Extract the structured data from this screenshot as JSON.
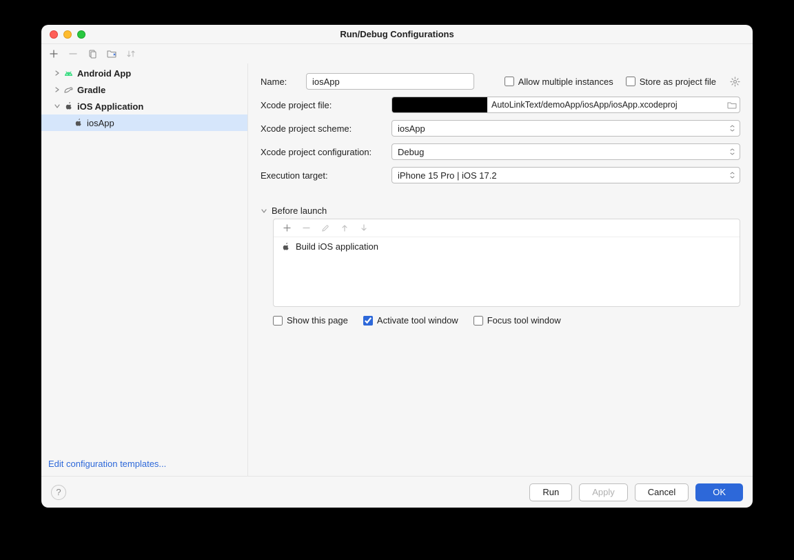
{
  "title": "Run/Debug Configurations",
  "tree": {
    "android": "Android App",
    "gradle": "Gradle",
    "ios_app_group": "iOS Application",
    "ios_app_item": "iosApp"
  },
  "edit_templates": "Edit configuration templates...",
  "form": {
    "name_label": "Name:",
    "name_value": "iosApp",
    "allow_multiple": "Allow multiple instances",
    "store_as_project": "Store as project file",
    "xcode_file_label": "Xcode project file:",
    "xcode_file_value": "AutoLinkText/demoApp/iosApp/iosApp.xcodeproj",
    "scheme_label": "Xcode project scheme:",
    "scheme_value": "iosApp",
    "config_label": "Xcode project configuration:",
    "config_value": "Debug",
    "target_label": "Execution target:",
    "target_value": "iPhone 15 Pro | iOS 17.2"
  },
  "before_launch": {
    "header": "Before launch",
    "item": "Build iOS application"
  },
  "launch_checks": {
    "show_page": "Show this page",
    "activate_tool": "Activate tool window",
    "focus_tool": "Focus tool window"
  },
  "buttons": {
    "run": "Run",
    "apply": "Apply",
    "cancel": "Cancel",
    "ok": "OK"
  }
}
